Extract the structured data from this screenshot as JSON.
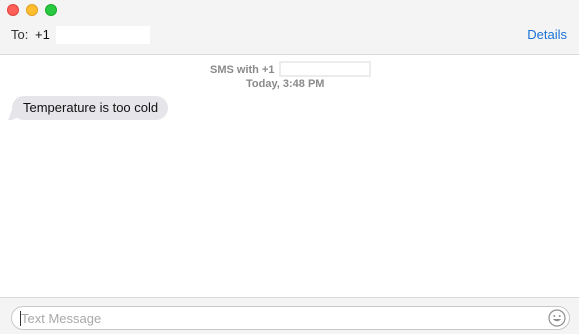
{
  "header": {
    "to_label": "To:",
    "recipient_prefix": "+1",
    "details_label": "Details"
  },
  "conversation": {
    "service_label": "SMS with +1",
    "timestamp": "Today, 3:48 PM",
    "messages": [
      {
        "direction": "incoming",
        "text": "Temperature is too cold"
      }
    ]
  },
  "compose": {
    "placeholder": "Text Message",
    "value": "",
    "emoji_icon": "smiley-face-icon"
  },
  "colors": {
    "accent": "#1a73d6",
    "incoming_bubble": "#e5e5ea",
    "traffic_close": "#ff5f57",
    "traffic_minimize": "#febc2e",
    "traffic_zoom": "#28c840"
  }
}
